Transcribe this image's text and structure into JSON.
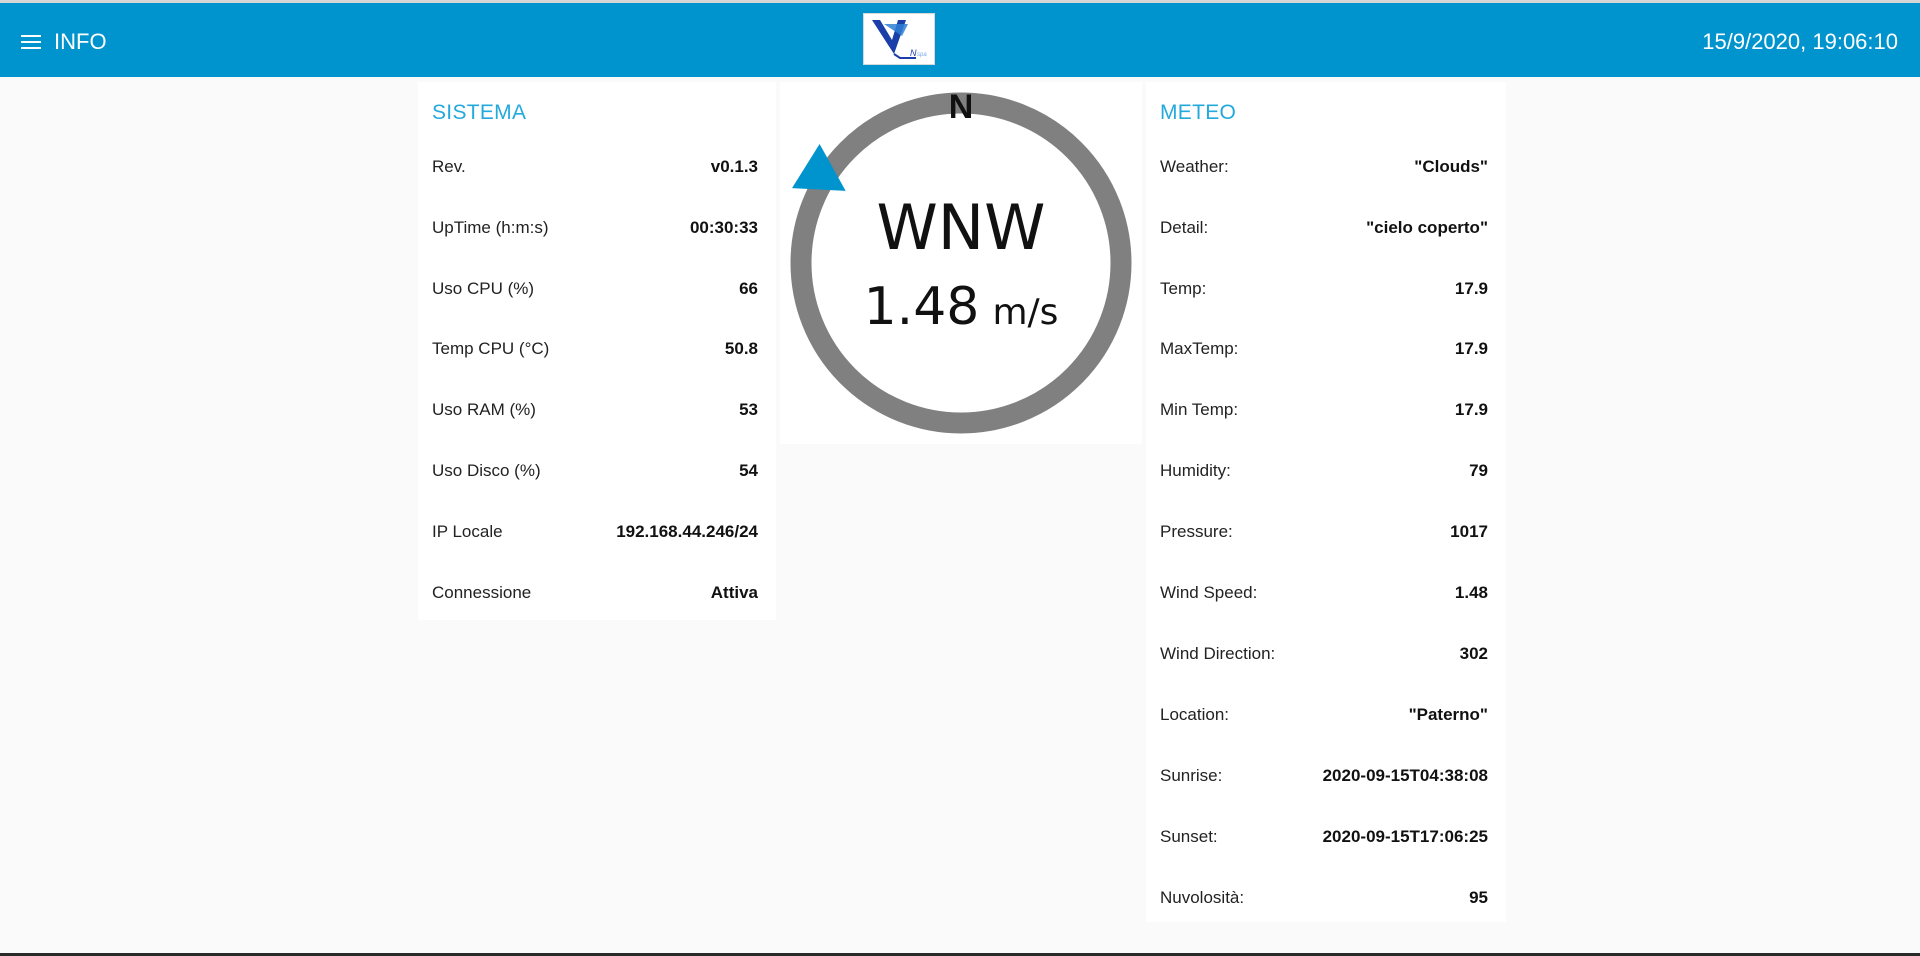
{
  "header": {
    "title": "INFO",
    "datetime": "15/9/2020, 19:06:10",
    "accent_color": "#0094ce"
  },
  "sistema": {
    "title": "SISTEMA",
    "rows": [
      {
        "label": "Rev.",
        "value": "v0.1.3"
      },
      {
        "label": "UpTime (h:m:s)",
        "value": "00:30:33"
      },
      {
        "label": "Uso CPU (%)",
        "value": "66"
      },
      {
        "label": "Temp CPU (°C)",
        "value": "50.8"
      },
      {
        "label": "Uso RAM (%)",
        "value": "53"
      },
      {
        "label": "Uso Disco (%)",
        "value": "54"
      },
      {
        "label": "IP Locale",
        "value": "192.168.44.246/24"
      },
      {
        "label": "Connessione",
        "value": "Attiva"
      }
    ]
  },
  "compass": {
    "north_label": "N",
    "direction": "WNW",
    "speed": "1.48",
    "unit": "m/s",
    "bearing_deg": 302,
    "ring_color": "#808080",
    "pointer_color": "#0094ce"
  },
  "meteo": {
    "title": "METEO",
    "rows": [
      {
        "label": "Weather:",
        "value": "\"Clouds\""
      },
      {
        "label": "Detail:",
        "value": "\"cielo coperto\""
      },
      {
        "label": "Temp:",
        "value": "17.9"
      },
      {
        "label": "MaxTemp:",
        "value": "17.9"
      },
      {
        "label": "Min Temp:",
        "value": "17.9"
      },
      {
        "label": "Humidity:",
        "value": "79"
      },
      {
        "label": "Pressure:",
        "value": "1017"
      },
      {
        "label": "Wind Speed:",
        "value": "1.48"
      },
      {
        "label": "Wind Direction:",
        "value": "302"
      },
      {
        "label": "Location:",
        "value": "\"Paterno\""
      },
      {
        "label": "Sunrise:",
        "value": "2020-09-15T04:38:08"
      },
      {
        "label": "Sunset:",
        "value": "2020-09-15T17:06:25"
      },
      {
        "label": "Nuvolosità:",
        "value": "95"
      }
    ]
  }
}
